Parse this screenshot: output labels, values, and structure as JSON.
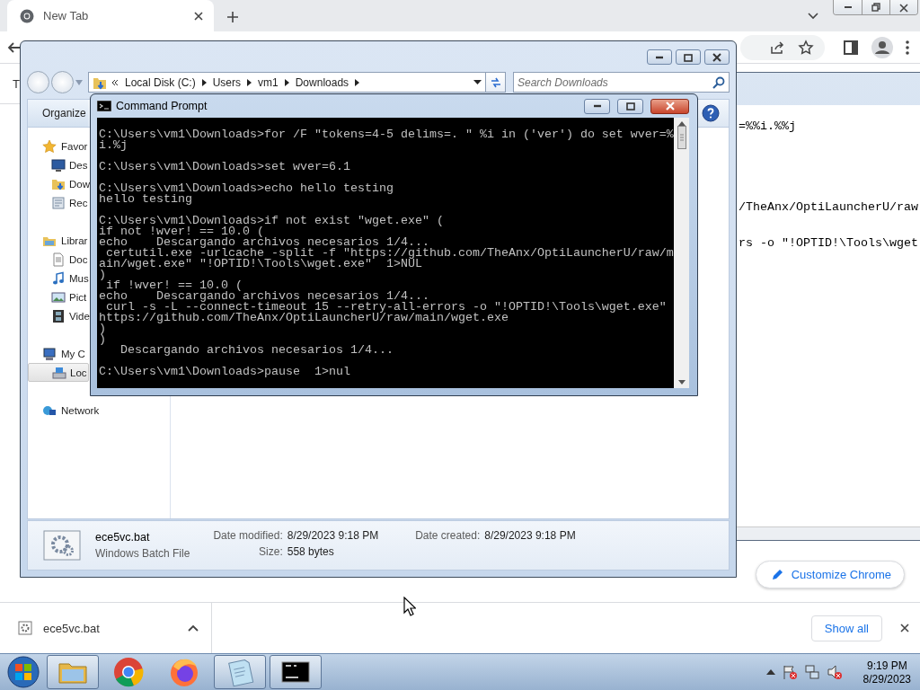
{
  "browser": {
    "tabs": [
      {
        "label": "New Tab",
        "selected": true
      }
    ],
    "bookmark_text": "T",
    "customize_button": "Customize Chrome",
    "downloads": {
      "items": [
        {
          "filename": "ece5vc.bat"
        }
      ],
      "show_all": "Show all"
    }
  },
  "notepad": {
    "lines": [
      "=%%i.%%j",
      "/TheAnx/OptiLauncherU/raw",
      "rs -o \"!OPTID!\\Tools\\wget"
    ]
  },
  "explorer": {
    "breadcrumb": [
      "Local Disk (C:)",
      "Users",
      "vm1",
      "Downloads"
    ],
    "search": {
      "placeholder": "Search Downloads"
    },
    "toolbar": [
      "Organize"
    ],
    "nav": [
      {
        "label": "Favor",
        "kind": "favorites",
        "selected": false,
        "children": [
          {
            "label": "Des",
            "kind": "desktop",
            "selected": false
          },
          {
            "label": "Dow",
            "kind": "downloads",
            "selected": false
          },
          {
            "label": "Rec",
            "kind": "recent",
            "selected": false
          }
        ]
      },
      {
        "label": "Librar",
        "kind": "libraries",
        "selected": false,
        "children": [
          {
            "label": "Doc",
            "kind": "document",
            "selected": false
          },
          {
            "label": "Mus",
            "kind": "music",
            "selected": false
          },
          {
            "label": "Pict",
            "kind": "pictures",
            "selected": false
          },
          {
            "label": "Vide",
            "kind": "videos",
            "selected": false
          }
        ]
      },
      {
        "label": "My C",
        "kind": "computer",
        "selected": false,
        "children": [
          {
            "label": "Loc",
            "kind": "drive",
            "selected": true
          }
        ]
      },
      {
        "label": "Network",
        "kind": "network",
        "selected": false
      }
    ],
    "details": {
      "filename": "ece5vc.bat",
      "file_type": "Windows Batch File",
      "fields": [
        {
          "label": "Date modified:",
          "value": "8/29/2023 9:18 PM"
        },
        {
          "label": "Size:",
          "value": "558 bytes"
        },
        {
          "label": "Date created:",
          "value": "8/29/2023 9:18 PM"
        }
      ]
    }
  },
  "command_prompt": {
    "title": "Command Prompt",
    "blocks": [
      [
        "C:\\Users\\vm1\\Downloads>for /F \"tokens=4-5 delims=. \" %i in ('ver') do set wver=%",
        "i.%j"
      ],
      [
        "C:\\Users\\vm1\\Downloads>set wver=6.1"
      ],
      [
        "C:\\Users\\vm1\\Downloads>echo hello testing",
        "hello testing"
      ],
      [
        "C:\\Users\\vm1\\Downloads>if not exist \"wget.exe\" (",
        "if not !wver! == 10.0 (",
        "echo    Descargando archivos necesarios 1/4...",
        " certutil.exe -urlcache -split -f \"https://github.com/TheAnx/OptiLauncherU/raw/m",
        "ain/wget.exe\" \"!OPTID!\\Tools\\wget.exe\"  1>NUL",
        ")",
        " if !wver! == 10.0 (",
        "echo    Descargando archivos necesarios 1/4...",
        " curl -s -L --connect-timeout 15 --retry-all-errors -o \"!OPTID!\\Tools\\wget.exe\"",
        "https://github.com/TheAnx/OptiLauncherU/raw/main/wget.exe",
        ")",
        ")",
        "   Descargando archivos necesarios 1/4..."
      ],
      [
        "C:\\Users\\vm1\\Downloads>pause  1>nul"
      ]
    ]
  },
  "taskbar": {
    "buttons": [
      {
        "kind": "explorer",
        "running": true
      },
      {
        "kind": "chrome",
        "running": false
      },
      {
        "kind": "firefox",
        "running": false
      },
      {
        "kind": "notepad",
        "running": true
      },
      {
        "kind": "cmd",
        "running": true
      }
    ],
    "time": "9:19 PM",
    "date": "8/29/2023"
  }
}
